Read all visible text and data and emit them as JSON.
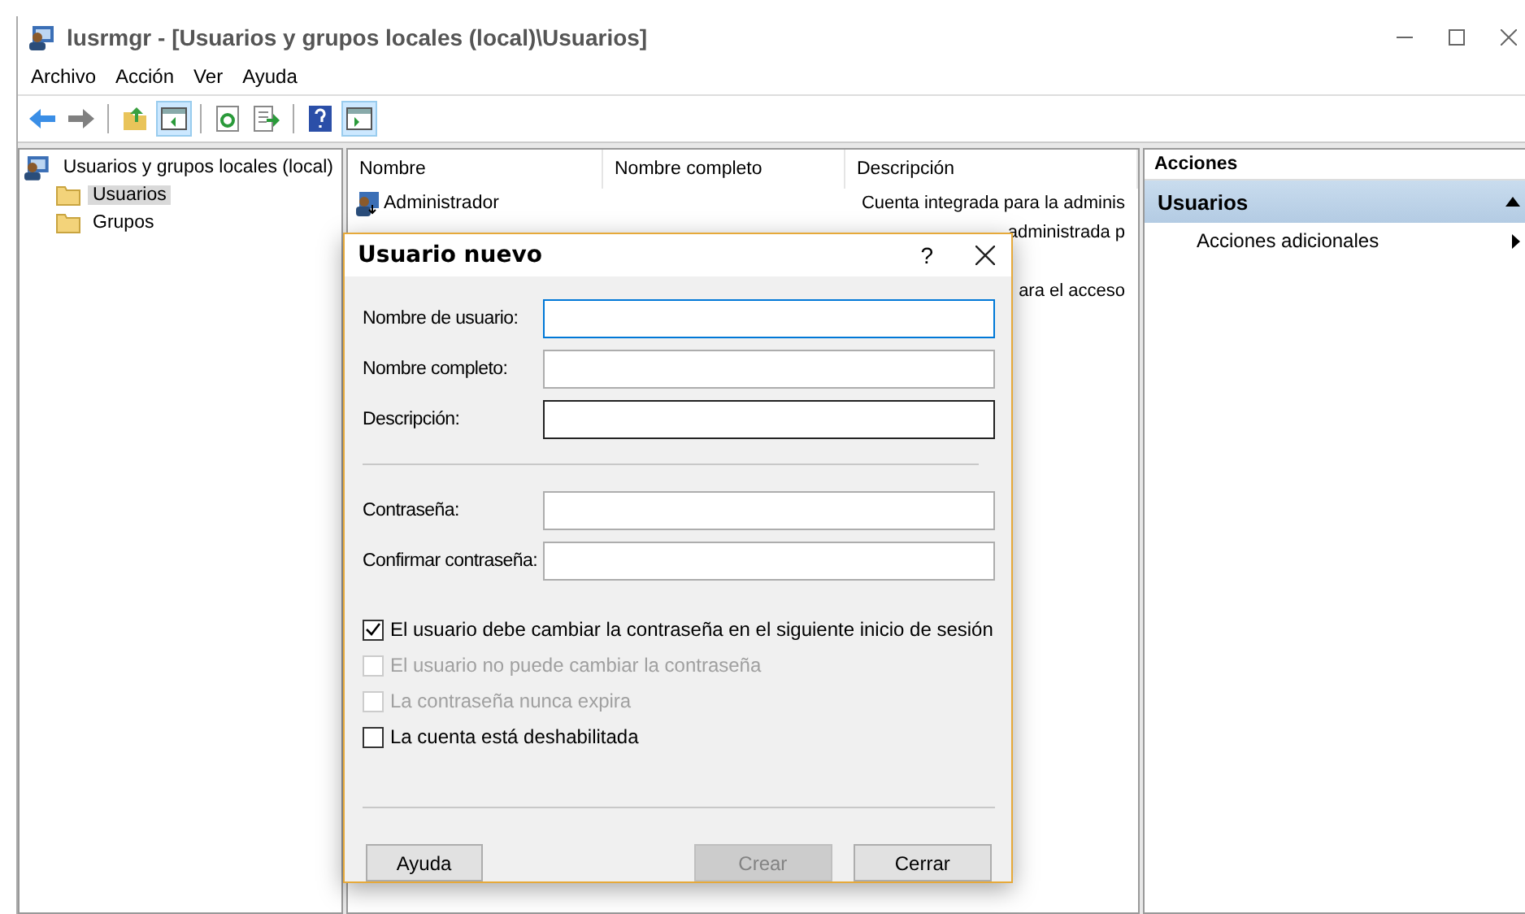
{
  "window": {
    "title": "lusrmgr - [Usuarios y grupos locales (local)\\Usuarios]"
  },
  "menu": [
    "Archivo",
    "Acción",
    "Ver",
    "Ayuda"
  ],
  "toolbar": [
    {
      "kind": "back",
      "pressed": false
    },
    {
      "kind": "forward",
      "pressed": false
    },
    {
      "kind": "up",
      "pressed": false
    },
    {
      "kind": "tree",
      "pressed": true
    },
    {
      "kind": "refresh",
      "pressed": false
    },
    {
      "kind": "export",
      "pressed": false
    },
    {
      "kind": "help",
      "pressed": false
    },
    {
      "kind": "actionpane",
      "pressed": true
    }
  ],
  "tree": {
    "label": "Usuarios y grupos locales (local)",
    "children": [
      {
        "label": "Usuarios",
        "selected": true
      },
      {
        "label": "Grupos",
        "selected": false
      }
    ]
  },
  "table": {
    "columns": [
      "Nombre",
      "Nombre completo",
      "Descripción"
    ],
    "rows": [
      {
        "name": "Administrador",
        "description": "Cuenta integrada para la adminis"
      },
      {
        "description": "administrada p"
      },
      {},
      {
        "description": "ara el acceso"
      }
    ]
  },
  "actions": {
    "title": "Acciones",
    "section": "Usuarios",
    "expanded": true,
    "items": [
      "Acciones adicionales"
    ]
  },
  "dialog": {
    "title": "Usuario nuevo",
    "help": "?",
    "fields": [
      {
        "label": "Nombre de usuario:",
        "focused": true,
        "hovered": false
      },
      {
        "label": "Nombre completo:",
        "focused": false,
        "hovered": false
      },
      {
        "label": "Descripción:",
        "focused": false,
        "hovered": true
      }
    ],
    "password_fields": [
      {
        "label": "Contraseña:",
        "focused": false,
        "hovered": false
      },
      {
        "label": "Confirmar contraseña:",
        "focused": false,
        "hovered": false
      }
    ],
    "checkboxes": [
      {
        "label": "El usuario debe cambiar la contraseña en el siguiente inicio de sesión",
        "checked": true,
        "disabled": false
      },
      {
        "label": "El usuario no puede cambiar la contraseña",
        "checked": false,
        "disabled": true
      },
      {
        "label": "La contraseña nunca expira",
        "checked": false,
        "disabled": true
      },
      {
        "label": "La cuenta está deshabilitada",
        "checked": false,
        "disabled": false
      }
    ],
    "buttons": [
      {
        "label": "Ayuda",
        "disabled": false
      },
      {
        "label": "Crear",
        "disabled": true
      },
      {
        "label": "Cerrar",
        "disabled": false
      }
    ]
  }
}
